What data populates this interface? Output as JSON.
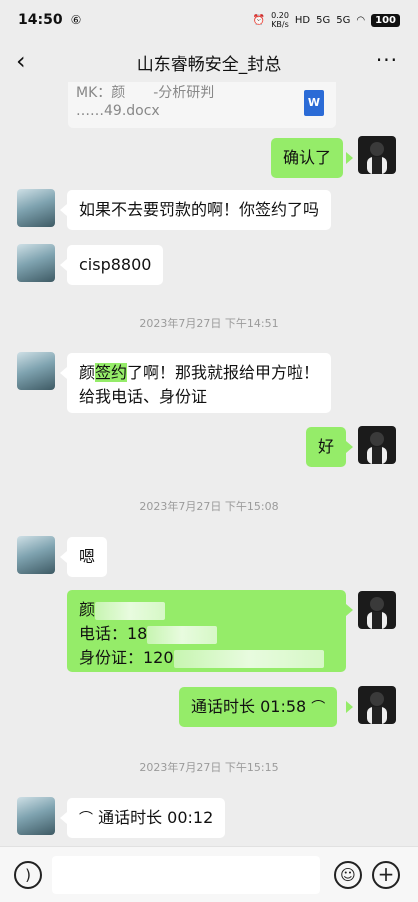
{
  "status": {
    "time": "14:50",
    "indicator": "⑥",
    "speed_top": "0.20",
    "speed_bottom": "KB/s",
    "hd": "HD",
    "signal1": "5G",
    "signal2": "5G",
    "battery": "100"
  },
  "header": {
    "back_icon": "chevron-left-icon",
    "title": "山东睿畅安全_封总",
    "more_icon": "more-icon"
  },
  "file": {
    "line1": "MK：颜　　-分析研判",
    "line2": "……49.docx",
    "icon_label": "W"
  },
  "messages": {
    "m1": "确认了",
    "m2": "如果不去要罚款的啊！你签约了吗",
    "m3": "cisp8800",
    "ts1": "2023年7月27日 下午14:51",
    "m4_pre": "颜",
    "m4_hl": "签约",
    "m4_post": "了啊！那我就报给甲方啦！",
    "m4_line2": "给我电话、身份证",
    "m5": "好",
    "ts2": "2023年7月27日 下午15:08",
    "m6": "嗯",
    "m7_name": "颜",
    "m7_phone_label": "电话：18",
    "m7_id_label": "身份证：120",
    "m8": "通话时长 01:58",
    "ts3": "2023年7月27日 下午15:15",
    "m9": "通话时长 00:12"
  },
  "bottom": {
    "voice_icon": "voice-icon",
    "emoji_icon": "emoji-icon",
    "plus_icon": "plus-icon"
  }
}
